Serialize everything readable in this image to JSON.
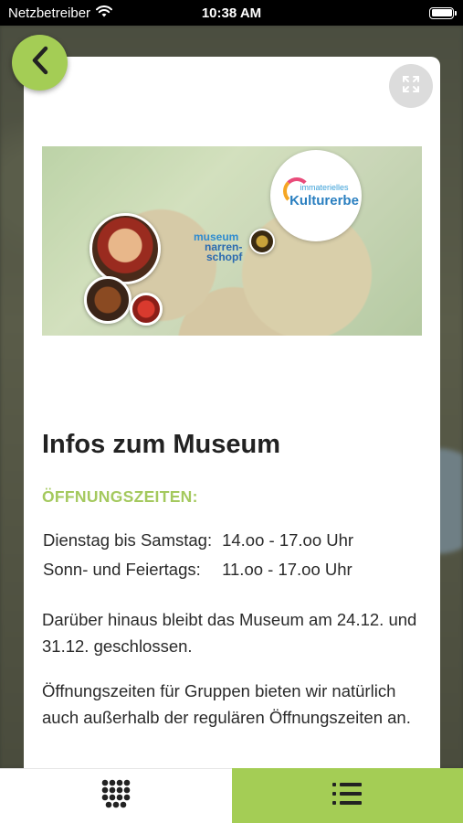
{
  "status_bar": {
    "carrier": "Netzbetreiber",
    "time": "10:38 AM"
  },
  "colors": {
    "accent": "#a4cd55",
    "subheading": "#a4c95e",
    "text": "#2a2a2a"
  },
  "icons": {
    "back": "chevron-left-icon",
    "expand": "expand-icon",
    "grid": "grid-dots-icon",
    "list": "list-icon"
  },
  "banner": {
    "badge_line1": "immaterielles",
    "badge_line2": "Kulturerbe",
    "logo_line1": "museum",
    "logo_line2": "narren-",
    "logo_line3": "schopf"
  },
  "content": {
    "heading": "Infos zum Museum",
    "subheading": "ÖFFNUNGSZEITEN:",
    "hours": [
      {
        "days": "Dienstag bis Samstag:",
        "time": "14.oo - 17.oo Uhr"
      },
      {
        "days": "Sonn- und Feiertags:",
        "time": "11.oo - 17.oo Uhr"
      }
    ],
    "paragraph_1": "Darüber hinaus bleibt das Museum am 24.12. und 31.12. geschlossen.",
    "paragraph_2": "Öffnungszeiten für Gruppen bieten wir natürlich auch außerhalb der regulären Öffnungszeiten an."
  }
}
